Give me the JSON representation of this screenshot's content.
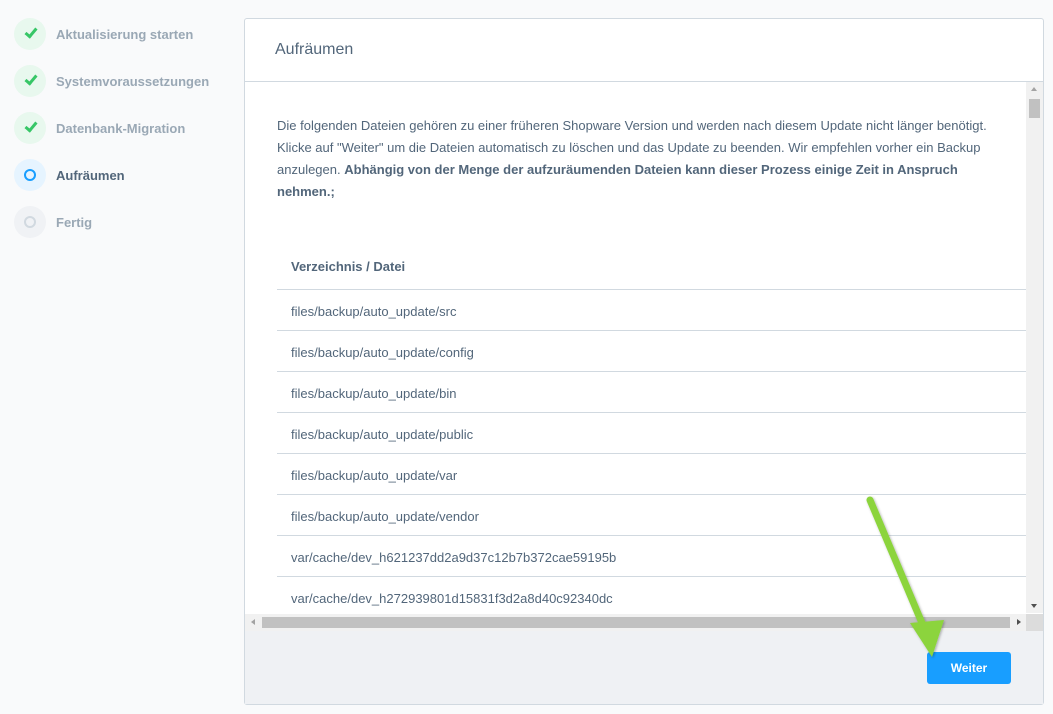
{
  "steps": [
    {
      "label": "Aktualisierung starten",
      "state": "done"
    },
    {
      "label": "Systemvoraussetzungen",
      "state": "done"
    },
    {
      "label": "Datenbank-Migration",
      "state": "done"
    },
    {
      "label": "Aufräumen",
      "state": "active"
    },
    {
      "label": "Fertig",
      "state": "pending"
    }
  ],
  "card": {
    "title": "Aufräumen",
    "intro_text": "Die folgenden Dateien gehören zu einer früheren Shopware Version und werden nach diesem Update nicht länger benötigt. Klicke auf \"Weiter\" um die Dateien automatisch zu löschen und das Update zu beenden. Wir empfehlen vorher ein Backup anzulegen.",
    "intro_bold": "Abhängig von der Menge der aufzuräumenden Dateien kann dieser Prozess einige Zeit in Anspruch nehmen.;",
    "table": {
      "header": "Verzeichnis / Datei",
      "rows": [
        "files/backup/auto_update/src",
        "files/backup/auto_update/config",
        "files/backup/auto_update/bin",
        "files/backup/auto_update/public",
        "files/backup/auto_update/var",
        "files/backup/auto_update/vendor",
        "var/cache/dev_h621237dd2a9d37c12b7b372cae59195b",
        "var/cache/dev_h272939801d15831f3d2a8d40c92340dc"
      ]
    },
    "next_button": "Weiter"
  },
  "colors": {
    "accent": "#189eff",
    "success": "#37c667",
    "annotation_arrow": "#8cd43c"
  }
}
